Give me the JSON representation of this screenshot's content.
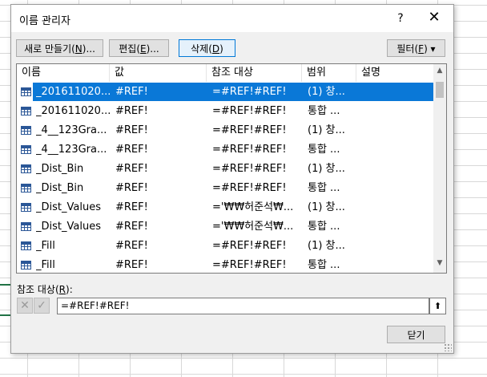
{
  "dialog": {
    "title": "이름 관리자",
    "help": "?",
    "close": "✕"
  },
  "toolbar": {
    "new_label": "새로 만들기(",
    "new_key": "N",
    "new_tail": ")...",
    "edit_label": "편집(",
    "edit_key": "E",
    "edit_tail": ")...",
    "delete_label": "삭제(",
    "delete_key": "D",
    "delete_tail": ")",
    "filter_label": "필터(",
    "filter_key": "F",
    "filter_tail": ") ▾"
  },
  "columns": [
    "이름",
    "값",
    "참조 대상",
    "범위",
    "설명"
  ],
  "rows": [
    {
      "name": "_201611020...",
      "value": "#REF!",
      "refers_to": "=#REF!#REF!",
      "scope": "(1) 창...",
      "comment": "",
      "selected": true
    },
    {
      "name": "_201611020...",
      "value": "#REF!",
      "refers_to": "=#REF!#REF!",
      "scope": "통합 ...",
      "comment": ""
    },
    {
      "name": "_4__123Gra...",
      "value": "#REF!",
      "refers_to": "=#REF!#REF!",
      "scope": "(1) 창...",
      "comment": ""
    },
    {
      "name": "_4__123Gra...",
      "value": "#REF!",
      "refers_to": "=#REF!#REF!",
      "scope": "통합 ...",
      "comment": ""
    },
    {
      "name": "_Dist_Bin",
      "value": "#REF!",
      "refers_to": "=#REF!#REF!",
      "scope": "(1) 창...",
      "comment": ""
    },
    {
      "name": "_Dist_Bin",
      "value": "#REF!",
      "refers_to": "=#REF!#REF!",
      "scope": "통합 ...",
      "comment": ""
    },
    {
      "name": "_Dist_Values",
      "value": "#REF!",
      "refers_to": "='₩₩허준석₩...",
      "scope": "(1) 창...",
      "comment": ""
    },
    {
      "name": "_Dist_Values",
      "value": "#REF!",
      "refers_to": "='₩₩허준석₩...",
      "scope": "통합 ...",
      "comment": ""
    },
    {
      "name": "_Fill",
      "value": "#REF!",
      "refers_to": "=#REF!#REF!",
      "scope": "(1) 창...",
      "comment": ""
    },
    {
      "name": "_Fill",
      "value": "#REF!",
      "refers_to": "=#REF!#REF!",
      "scope": "통합 ...",
      "comment": ""
    }
  ],
  "reference": {
    "label": "참조 대상(",
    "key": "R",
    "tail": "):",
    "value": "=#REF!#REF!"
  },
  "footer": {
    "close_label": "닫기"
  },
  "icons": {
    "cancel": "cancel-x-icon",
    "confirm": "check-icon",
    "collapse": "collapse-dialog-icon",
    "name_row": "defined-name-grid-icon"
  },
  "colors": {
    "selection": "#0a78d7",
    "dialog_bg": "#f0f0f0",
    "sheet_green": "#217346"
  }
}
